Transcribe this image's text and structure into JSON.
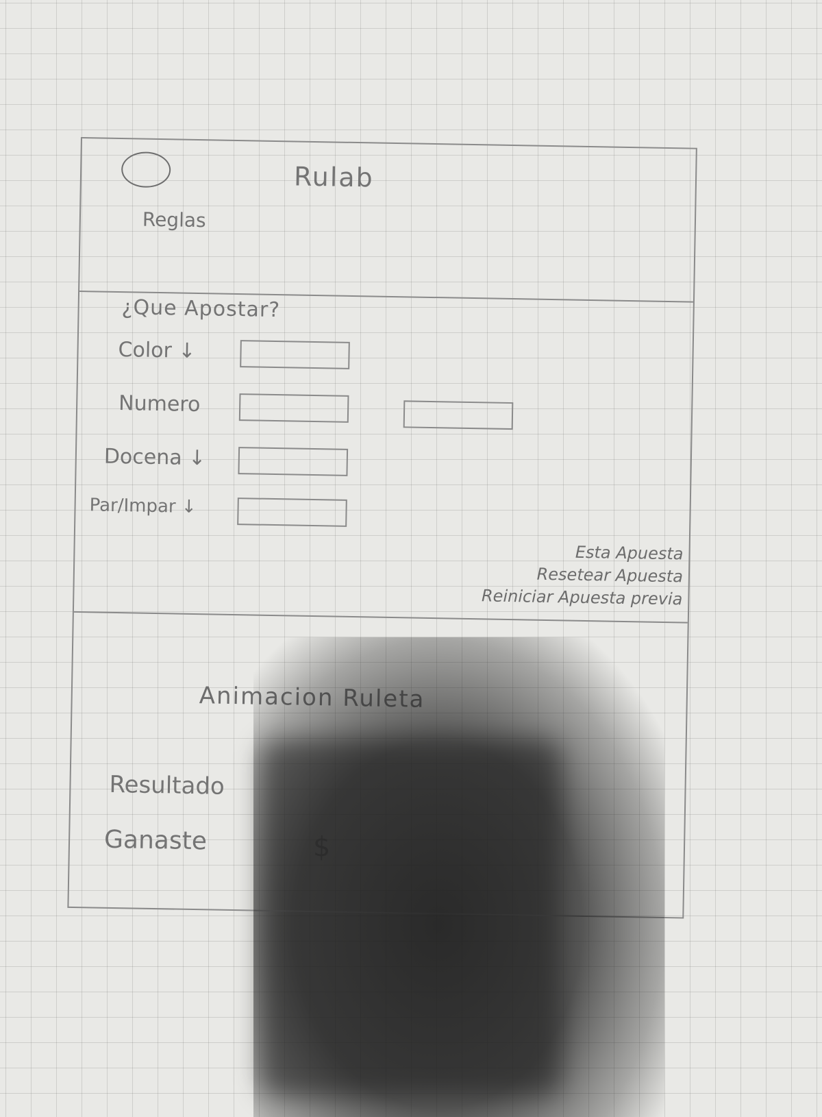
{
  "header": {
    "title": "Rulab",
    "rules_link": "Reglas"
  },
  "bet_form": {
    "question": "¿Que Apostar?",
    "fields": [
      {
        "label": "Color ↓"
      },
      {
        "label": "Numero"
      },
      {
        "label": "Docena ↓"
      },
      {
        "label": "Par/Impar ↓"
      }
    ]
  },
  "actions": {
    "items": [
      {
        "label": "Esta Apuesta"
      },
      {
        "label": "Resetear Apuesta"
      },
      {
        "label": "Reiniciar Apuesta previa"
      }
    ]
  },
  "roulette": {
    "animation_label": "Animacion Ruleta"
  },
  "results": {
    "result_label": "Resultado",
    "won_label": "Ganaste",
    "currency": "$"
  }
}
